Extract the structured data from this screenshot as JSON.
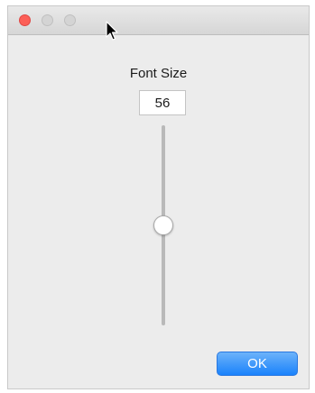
{
  "dialog": {
    "title": "Font Size",
    "font_size_value": "56",
    "ok_label": "OK"
  },
  "slider": {
    "orientation": "vertical",
    "value_fraction": 0.5
  },
  "colors": {
    "close_button": "#fc5f57",
    "ok_button": "#1a82fb",
    "window_background": "#ececec"
  },
  "icons": {
    "mouse_pointer": "arrow-cursor-icon"
  }
}
